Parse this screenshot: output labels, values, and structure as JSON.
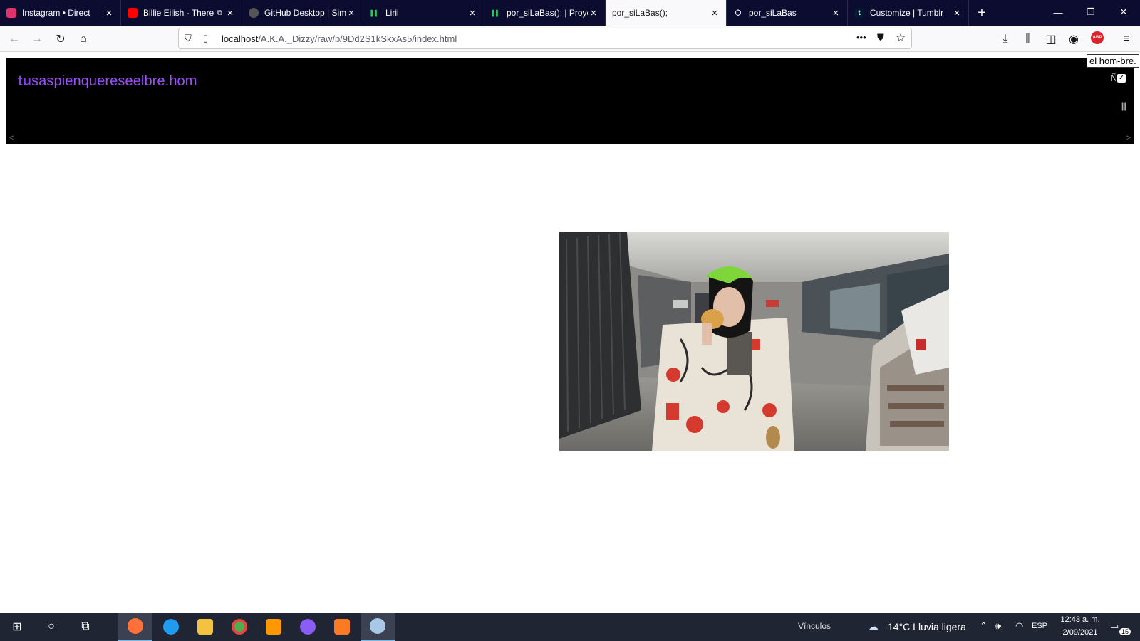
{
  "browser": {
    "tabs": [
      {
        "title": "Instagram • Direct",
        "icon": "instagram-icon",
        "color": "#e1306c"
      },
      {
        "title": "Billie Eilish - There",
        "icon": "youtube-icon",
        "color": "#ff0000",
        "extra": "⧉"
      },
      {
        "title": "GitHub Desktop | Sim",
        "icon": "github-icon",
        "color": "#24292e"
      },
      {
        "title": "Liril",
        "icon": "bars-icon",
        "color": "#2fc35f"
      },
      {
        "title": "por_siLaBas(); | Proye",
        "icon": "bars-icon",
        "color": "#2fc35f"
      },
      {
        "title": "por_siLaBas();",
        "icon": "",
        "color": "#ffffff",
        "active": true
      },
      {
        "title": "por_siLaBas",
        "icon": "codepen-icon",
        "color": "#ffffff"
      },
      {
        "title": "Customize | Tumblr",
        "icon": "tumblr-icon",
        "color": "#001935"
      }
    ],
    "url_host": "localhost",
    "url_path": "/A.K.A._Dizzy/raw/p/9Dd2S1kSkxAs5/index.html",
    "abp_label": "ABP"
  },
  "page": {
    "brand_bold": "tu",
    "brand_rest": "saspienquereseelbre.hom",
    "enye": "Ñ",
    "pause": "||",
    "tooltip": "el hom-bre.",
    "photo_alt": "Person with green hair eating in a shopping mall"
  },
  "taskbar": {
    "links": "Vínculos",
    "weather": "14°C  Lluvia ligera",
    "lang": "ESP",
    "time": "12:43 a. m.",
    "date": "2/09/2021",
    "notifications": "15"
  }
}
